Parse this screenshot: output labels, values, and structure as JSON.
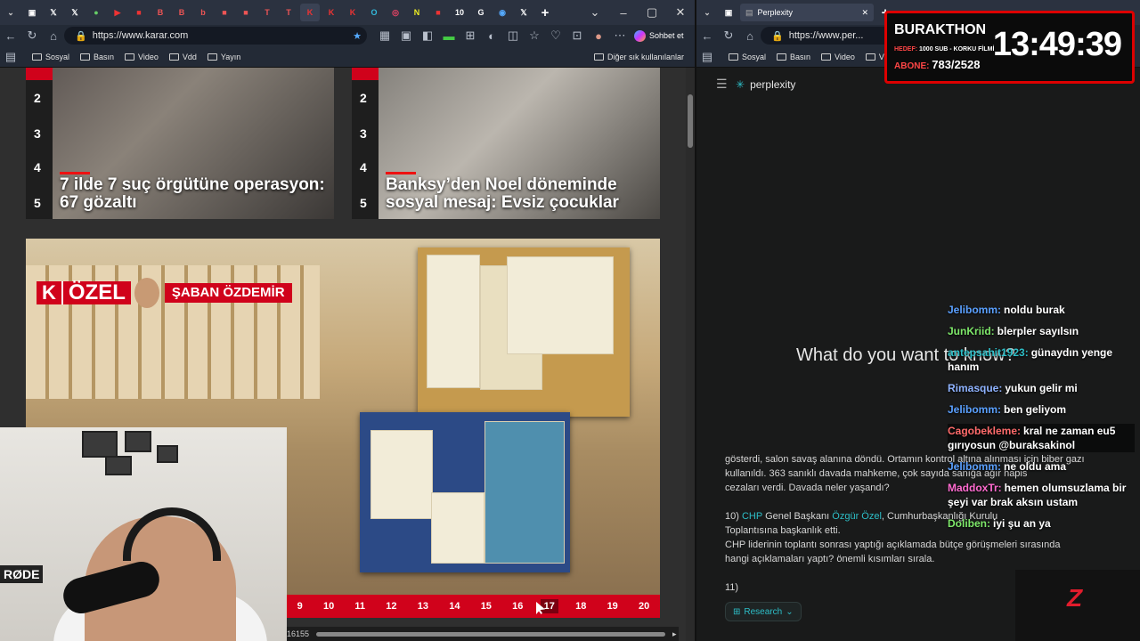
{
  "left_browser": {
    "url": "https://www.karar.com",
    "chat_button": "Sohbet et",
    "favorites": [
      "Sosyal",
      "Basın",
      "Video",
      "Vdd",
      "Yayın"
    ],
    "other_favorites": "Diğer sık kullanılanlar"
  },
  "right_browser": {
    "tab_title": "Perplexity",
    "url": "https://www.per...",
    "favorites": [
      "Sosyal",
      "Basın",
      "Video",
      "Vd"
    ]
  },
  "news": {
    "cards": [
      {
        "ranks": [
          "2",
          "3",
          "4",
          "5"
        ],
        "headline": "7 ilde 7 suç örgütüne operasyon: 67 gözaltı"
      },
      {
        "ranks": [
          "2",
          "3",
          "4",
          "5"
        ],
        "headline": "Banksy’den Noel döneminde sosyal mesaj: Evsiz çocuklar"
      }
    ],
    "hero": {
      "badge_k": "K",
      "badge": "ÖZEL",
      "author": "ŞABAN ÖZDEMİR"
    },
    "pages": [
      "9",
      "10",
      "11",
      "12",
      "13",
      "14",
      "15",
      "16",
      "17",
      "18",
      "19",
      "20"
    ],
    "current_page": "17",
    "counter": "16155"
  },
  "camera": {
    "mic_brand": "RØDE"
  },
  "perplexity": {
    "logo": "perplexity",
    "prompt": "What do you want to know?",
    "lines": [
      "gösterdi, salon savaş alanına döndü. Ortamın kontrol altına alınması için biber gazı",
      "kullanıldı. 363 sanıklı davada mahkeme, çok sayıda sanığa ağır hapis",
      "cezaları verdi. Davada neler yaşandı?"
    ],
    "item10_num": "10)",
    "item10_party": "CHP",
    "item10_mid": "Genel Başkanı",
    "item10_name": "Özgür Özel",
    "item10_rest": ", Cumhurbaşkanlığı Kurulu",
    "item10_line2": "Toplantısına başkanlık etti.",
    "item10_line3": "CHP liderinin toplantı sonrası yaptığı açıklamada bütçe görüşmeleri sırasında",
    "item10_line4": "hangi açıklamaları yaptı? önemli kısımları sırala.",
    "item11": "11)",
    "research": "Research"
  },
  "stream_hud": {
    "title": "BURAKTHON",
    "goal_label": "HEDEF:",
    "goal": "1000 SUB - KORKU FİLMİ",
    "sub_label": "ABONE:",
    "subs": "783/2528",
    "timer": "13:49:39"
  },
  "chat": [
    {
      "user": "Jelibomm:",
      "msg": "noldu burak",
      "color": "#5aa0ff"
    },
    {
      "user": "JunKriid:",
      "msg": "blerpler sayılsın",
      "color": "#7ee86a"
    },
    {
      "user": "antepsahit1923:",
      "msg": "günaydın yenge hanım",
      "color": "#2dbfc8"
    },
    {
      "user": "Rimasque:",
      "msg": "yukun gelir mi",
      "color": "#8fb3ff"
    },
    {
      "user": "Jelibomm:",
      "msg": "ben geliyom",
      "color": "#5aa0ff"
    },
    {
      "user": "Cagobekleme:",
      "msg": "kral ne zaman eu5 gırıyosun @buraksakinol",
      "color": "#ff6b6b"
    },
    {
      "user": "Jelibomm:",
      "msg": "ne oldu ama",
      "color": "#5aa0ff"
    },
    {
      "user": "MaddoxTr:",
      "msg": "hemen olumsuzlama bir şeyi var brak aksın ustam",
      "color": "#ff6bd0"
    },
    {
      "user": "Doliben:",
      "msg": "iyi şu an ya",
      "color": "#7ee86a"
    }
  ],
  "brand_mark": "Z"
}
